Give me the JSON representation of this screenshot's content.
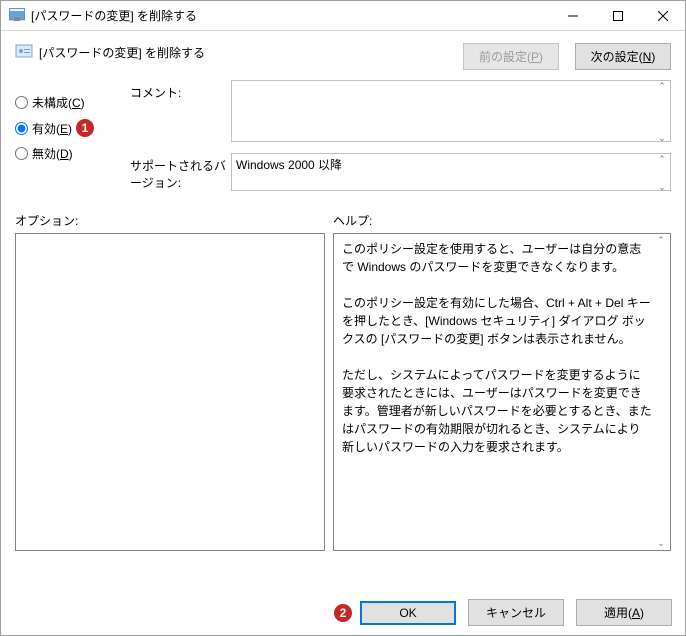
{
  "titlebar": {
    "text": "[パスワードの変更] を削除する"
  },
  "header": {
    "title": "[パスワードの変更] を削除する"
  },
  "nav": {
    "prev": "前の設定(P)",
    "next": "次の設定(N)"
  },
  "radio": {
    "not_configured": "未構成(C)",
    "enabled": "有効(E)",
    "disabled": "無効(D)"
  },
  "fields": {
    "comment_label": "コメント:",
    "comment_value": "",
    "support_label": "サポートされるバージョン:",
    "support_value": "Windows 2000 以降"
  },
  "labels": {
    "options": "オプション:",
    "help": "ヘルプ:"
  },
  "help": {
    "text": "このポリシー設定を使用すると、ユーザーは自分の意志で Windows のパスワードを変更できなくなります。\n\nこのポリシー設定を有効にした場合、Ctrl + Alt + Del キーを押したとき、[Windows セキュリティ] ダイアログ ボックスの [パスワードの変更] ボタンは表示されません。\n\nただし、システムによってパスワードを変更するように要求されたときには、ユーザーはパスワードを変更できます。管理者が新しいパスワードを必要とするとき、またはパスワードの有効期限が切れるとき、システムにより新しいパスワードの入力を要求されます。"
  },
  "footer": {
    "ok": "OK",
    "cancel": "キャンセル",
    "apply": "適用(A)"
  },
  "callouts": {
    "one": "1",
    "two": "2"
  }
}
